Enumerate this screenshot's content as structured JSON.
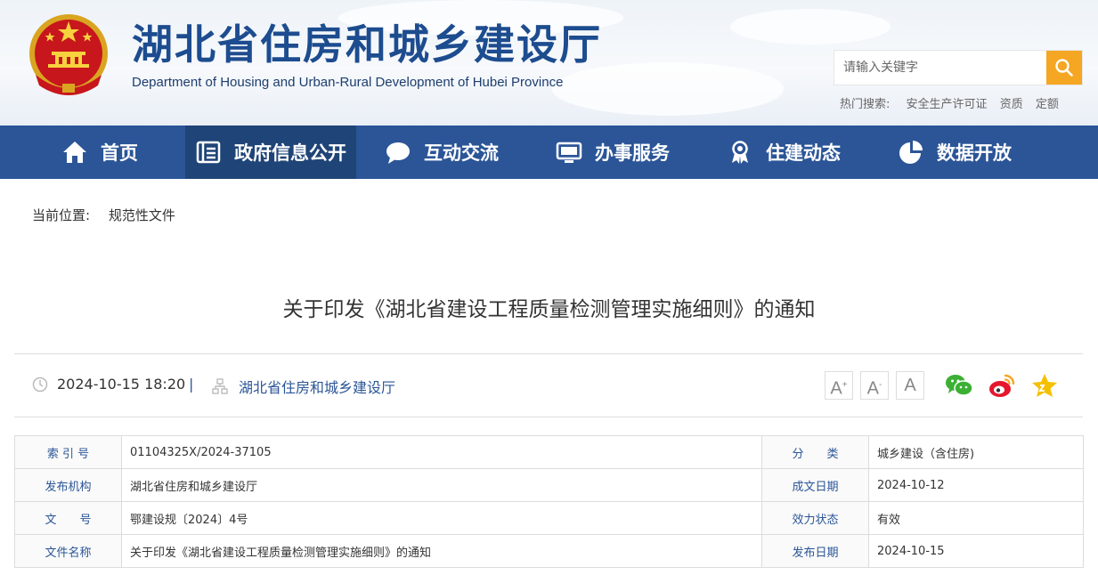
{
  "header": {
    "title": "湖北省住房和城乡建设厅",
    "subtitle": "Department of Housing and Urban-Rural Development of Hubei Province",
    "search_placeholder": "请输入关键字",
    "hot_search_label": "热门搜索:",
    "hot_search_terms": [
      "安全生产许可证",
      "资质",
      "定额"
    ]
  },
  "nav": [
    {
      "label": "首页",
      "icon": "home-icon"
    },
    {
      "label": "政府信息公开",
      "icon": "document-list-icon",
      "active": true
    },
    {
      "label": "互动交流",
      "icon": "chat-bubble-icon"
    },
    {
      "label": "办事服务",
      "icon": "monitor-icon"
    },
    {
      "label": "住建动态",
      "icon": "award-badge-icon"
    },
    {
      "label": "数据开放",
      "icon": "pie-chart-icon"
    }
  ],
  "breadcrumb": {
    "label": "当前位置:",
    "current": "规范性文件"
  },
  "article": {
    "title": "关于印发《湖北省建设工程质量检测管理实施细则》的通知",
    "datetime": "2024-10-15 18:20",
    "separator": "|",
    "source": "湖北省住房和城乡建设厅"
  },
  "font_size_buttons": [
    "A",
    "A",
    "A"
  ],
  "share_icons": [
    "wechat-icon",
    "weibo-icon",
    "favorite-star-icon"
  ],
  "info_table": [
    {
      "l1": "索 引 号",
      "v1": "01104325X/2024-37105",
      "l2": "分　　类",
      "v2": "城乡建设（含住房)"
    },
    {
      "l1": "发布机构",
      "v1": "湖北省住房和城乡建设厅",
      "l2": "成文日期",
      "v2": "2024-10-12"
    },
    {
      "l1": "文　　号",
      "v1": "鄂建设规〔2024〕4号",
      "l2": "效力状态",
      "v2": "有效"
    },
    {
      "l1": "文件名称",
      "v1": "关于印发《湖北省建设工程质量检测管理实施细则》的通知",
      "l2": "发布日期",
      "v2": "2024-10-15"
    }
  ],
  "colors": {
    "nav_bg": "#2b5597",
    "nav_active": "#1f4477",
    "accent_orange": "#f5a623",
    "title_blue": "#1d4c8f"
  }
}
